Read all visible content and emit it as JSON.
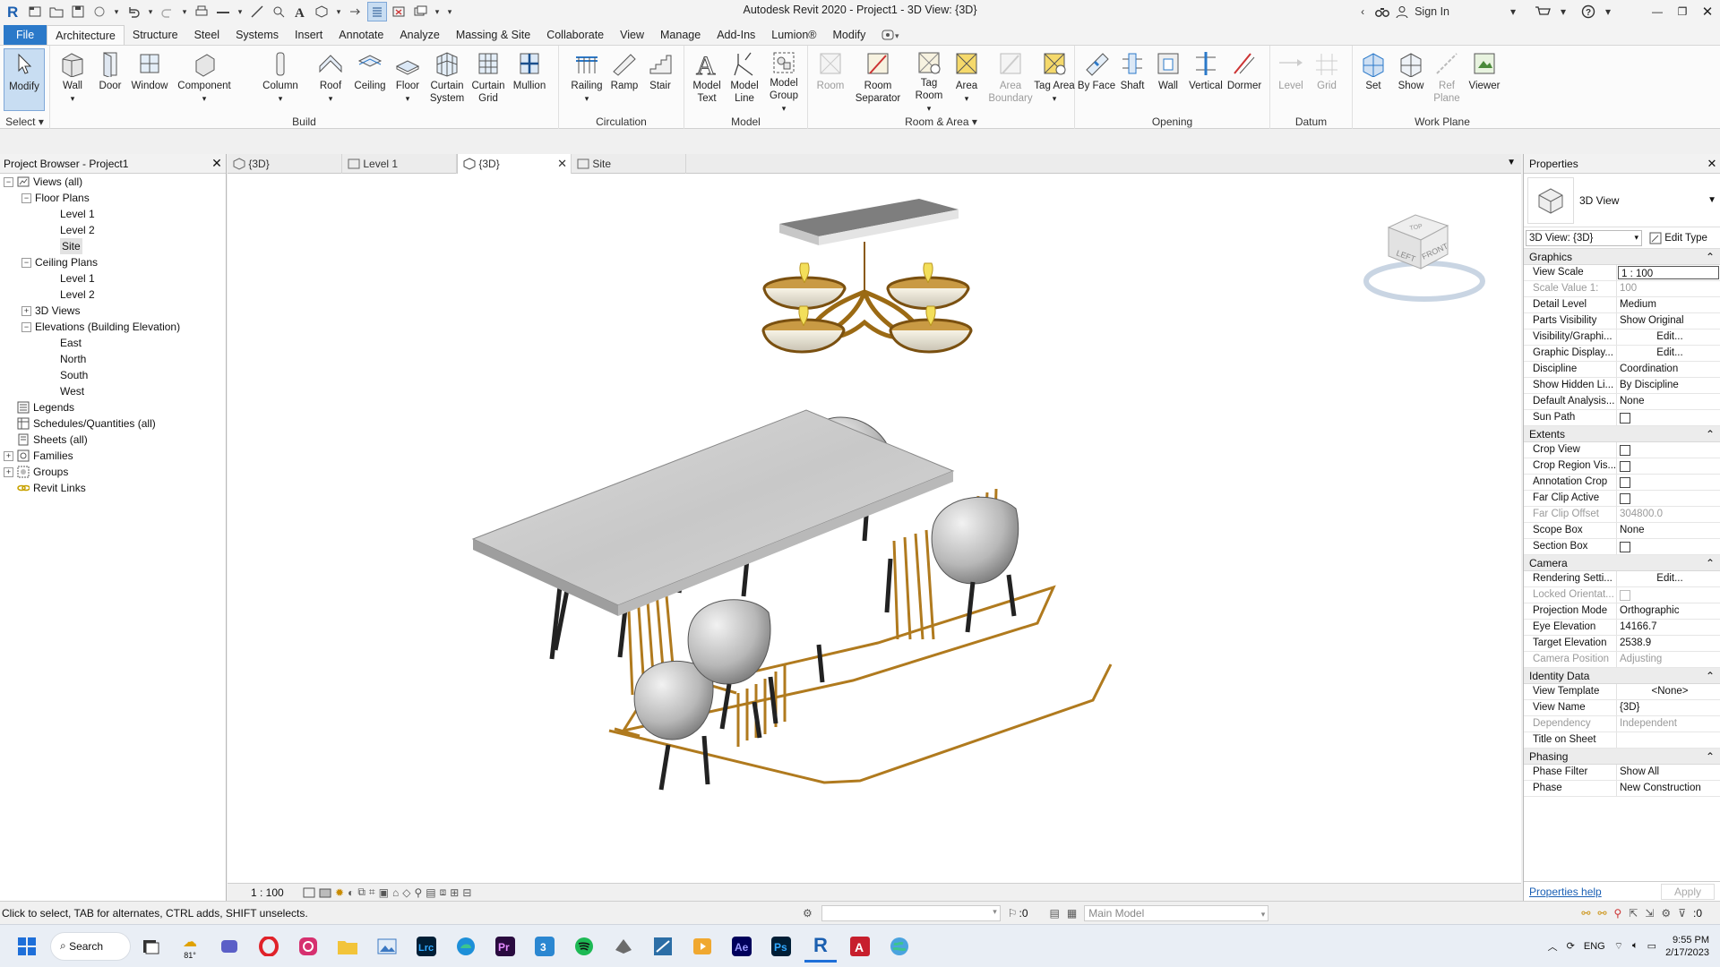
{
  "app": {
    "title": "Autodesk Revit 2020 - Project1 - 3D View: {3D}",
    "sign_in": "Sign In"
  },
  "menu": {
    "tabs": [
      "File",
      "Architecture",
      "Structure",
      "Steel",
      "Systems",
      "Insert",
      "Annotate",
      "Analyze",
      "Massing & Site",
      "Collaborate",
      "View",
      "Manage",
      "Add-Ins",
      "Lumion®",
      "Modify"
    ],
    "active": "Architecture"
  },
  "ribbon": {
    "select_label": "Select",
    "panels": {
      "build": "Build",
      "circulation": "Circulation",
      "model": "Model",
      "room_area": "Room & Area",
      "opening": "Opening",
      "datum": "Datum",
      "work_plane": "Work Plane"
    },
    "buttons": {
      "modify": "Modify",
      "wall": "Wall",
      "door": "Door",
      "window": "Window",
      "component": "Component",
      "column": "Column",
      "roof": "Roof",
      "ceiling": "Ceiling",
      "floor": "Floor",
      "curtain_system": "Curtain System",
      "curtain_grid": "Curtain Grid",
      "mullion": "Mullion",
      "railing": "Railing",
      "ramp": "Ramp",
      "stair": "Stair",
      "model_text": "Model Text",
      "model_line": "Model Line",
      "model_group": "Model Group",
      "room": "Room",
      "room_separator": "Room Separator",
      "tag_room": "Tag Room",
      "area": "Area",
      "area_boundary": "Area Boundary",
      "tag_area": "Tag Area",
      "by_face": "By Face",
      "shaft": "Shaft",
      "wall_opening": "Wall",
      "vertical": "Vertical",
      "dormer": "Dormer",
      "level": "Level",
      "grid": "Grid",
      "set": "Set",
      "show": "Show",
      "ref_plane": "Ref Plane",
      "viewer": "Viewer"
    }
  },
  "project_browser": {
    "title": "Project Browser - Project1",
    "items": [
      {
        "label": "Views (all)",
        "depth": 0,
        "toggle": "−",
        "icon": "views"
      },
      {
        "label": "Floor Plans",
        "depth": 1,
        "toggle": "−"
      },
      {
        "label": "Level 1",
        "depth": 2
      },
      {
        "label": "Level 2",
        "depth": 2
      },
      {
        "label": "Site",
        "depth": 2,
        "selected": true
      },
      {
        "label": "Ceiling Plans",
        "depth": 1,
        "toggle": "−"
      },
      {
        "label": "Level 1",
        "depth": 2
      },
      {
        "label": "Level 2",
        "depth": 2
      },
      {
        "label": "3D Views",
        "depth": 1,
        "toggle": "+"
      },
      {
        "label": "Elevations (Building Elevation)",
        "depth": 1,
        "toggle": "−"
      },
      {
        "label": "East",
        "depth": 2
      },
      {
        "label": "North",
        "depth": 2
      },
      {
        "label": "South",
        "depth": 2
      },
      {
        "label": "West",
        "depth": 2
      },
      {
        "label": "Legends",
        "depth": 0,
        "icon": "legends"
      },
      {
        "label": "Schedules/Quantities (all)",
        "depth": 0,
        "icon": "schedules"
      },
      {
        "label": "Sheets (all)",
        "depth": 0,
        "icon": "sheets"
      },
      {
        "label": "Families",
        "depth": 0,
        "toggle": "+",
        "icon": "families"
      },
      {
        "label": "Groups",
        "depth": 0,
        "toggle": "+",
        "icon": "groups"
      },
      {
        "label": "Revit Links",
        "depth": 0,
        "icon": "links"
      }
    ]
  },
  "view_tabs": [
    {
      "label": "{3D}",
      "active": false
    },
    {
      "label": "Level 1",
      "active": false
    },
    {
      "label": "{3D}",
      "active": true
    },
    {
      "label": "Site",
      "active": false
    }
  ],
  "viewcube": {
    "left": "LEFT",
    "front": "FRONT",
    "top": "TOP"
  },
  "view_bar": {
    "scale": "1 : 100"
  },
  "properties": {
    "title": "Properties",
    "type_name": "3D View",
    "selector": "3D View: {3D}",
    "edit_type": "Edit Type",
    "groups": [
      {
        "name": "Graphics",
        "rows": [
          {
            "k": "View Scale",
            "v": "1 : 100",
            "style": "boxed"
          },
          {
            "k": "Scale Value   1:",
            "v": "100",
            "dim": true
          },
          {
            "k": "Detail Level",
            "v": "Medium"
          },
          {
            "k": "Parts Visibility",
            "v": "Show Original"
          },
          {
            "k": "Visibility/Graphi...",
            "v": "Edit...",
            "style": "btn"
          },
          {
            "k": "Graphic Display...",
            "v": "Edit...",
            "style": "btn"
          },
          {
            "k": "Discipline",
            "v": "Coordination"
          },
          {
            "k": "Show Hidden Li...",
            "v": "By Discipline"
          },
          {
            "k": "Default Analysis...",
            "v": "None"
          },
          {
            "k": "Sun Path",
            "v": "",
            "style": "cb"
          }
        ]
      },
      {
        "name": "Extents",
        "rows": [
          {
            "k": "Crop View",
            "v": "",
            "style": "cb"
          },
          {
            "k": "Crop Region Vis...",
            "v": "",
            "style": "cb"
          },
          {
            "k": "Annotation Crop",
            "v": "",
            "style": "cb"
          },
          {
            "k": "Far Clip Active",
            "v": "",
            "style": "cb"
          },
          {
            "k": "Far Clip Offset",
            "v": "304800.0",
            "dim": true
          },
          {
            "k": "Scope Box",
            "v": "None"
          },
          {
            "k": "Section Box",
            "v": "",
            "style": "cb"
          }
        ]
      },
      {
        "name": "Camera",
        "rows": [
          {
            "k": "Rendering Setti...",
            "v": "Edit...",
            "style": "btn"
          },
          {
            "k": "Locked Orientat...",
            "v": "",
            "style": "cb",
            "dim": true
          },
          {
            "k": "Projection Mode",
            "v": "Orthographic"
          },
          {
            "k": "Eye Elevation",
            "v": "14166.7"
          },
          {
            "k": "Target Elevation",
            "v": "2538.9"
          },
          {
            "k": "Camera Position",
            "v": "Adjusting",
            "dim": true
          }
        ]
      },
      {
        "name": "Identity Data",
        "rows": [
          {
            "k": "View Template",
            "v": "<None>",
            "style": "btn"
          },
          {
            "k": "View Name",
            "v": "{3D}"
          },
          {
            "k": "Dependency",
            "v": "Independent",
            "dim": true
          },
          {
            "k": "Title on Sheet",
            "v": ""
          }
        ]
      },
      {
        "name": "Phasing",
        "rows": [
          {
            "k": "Phase Filter",
            "v": "Show All"
          },
          {
            "k": "Phase",
            "v": "New Construction"
          }
        ]
      }
    ],
    "help": "Properties help",
    "apply": "Apply"
  },
  "status": {
    "hint": "Click to select, TAB for alternates, CTRL adds, SHIFT unselects.",
    "zero": ":0",
    "model": "Main Model",
    "filter": ":0"
  },
  "taskbar": {
    "search": "Search",
    "weather": "81°",
    "lang": "ENG",
    "time": "9:55 PM",
    "date": "2/17/2023"
  },
  "colors": {
    "accent": "#2b79c9",
    "gold": "#b07a1e",
    "marble": "#cfcfcf"
  }
}
